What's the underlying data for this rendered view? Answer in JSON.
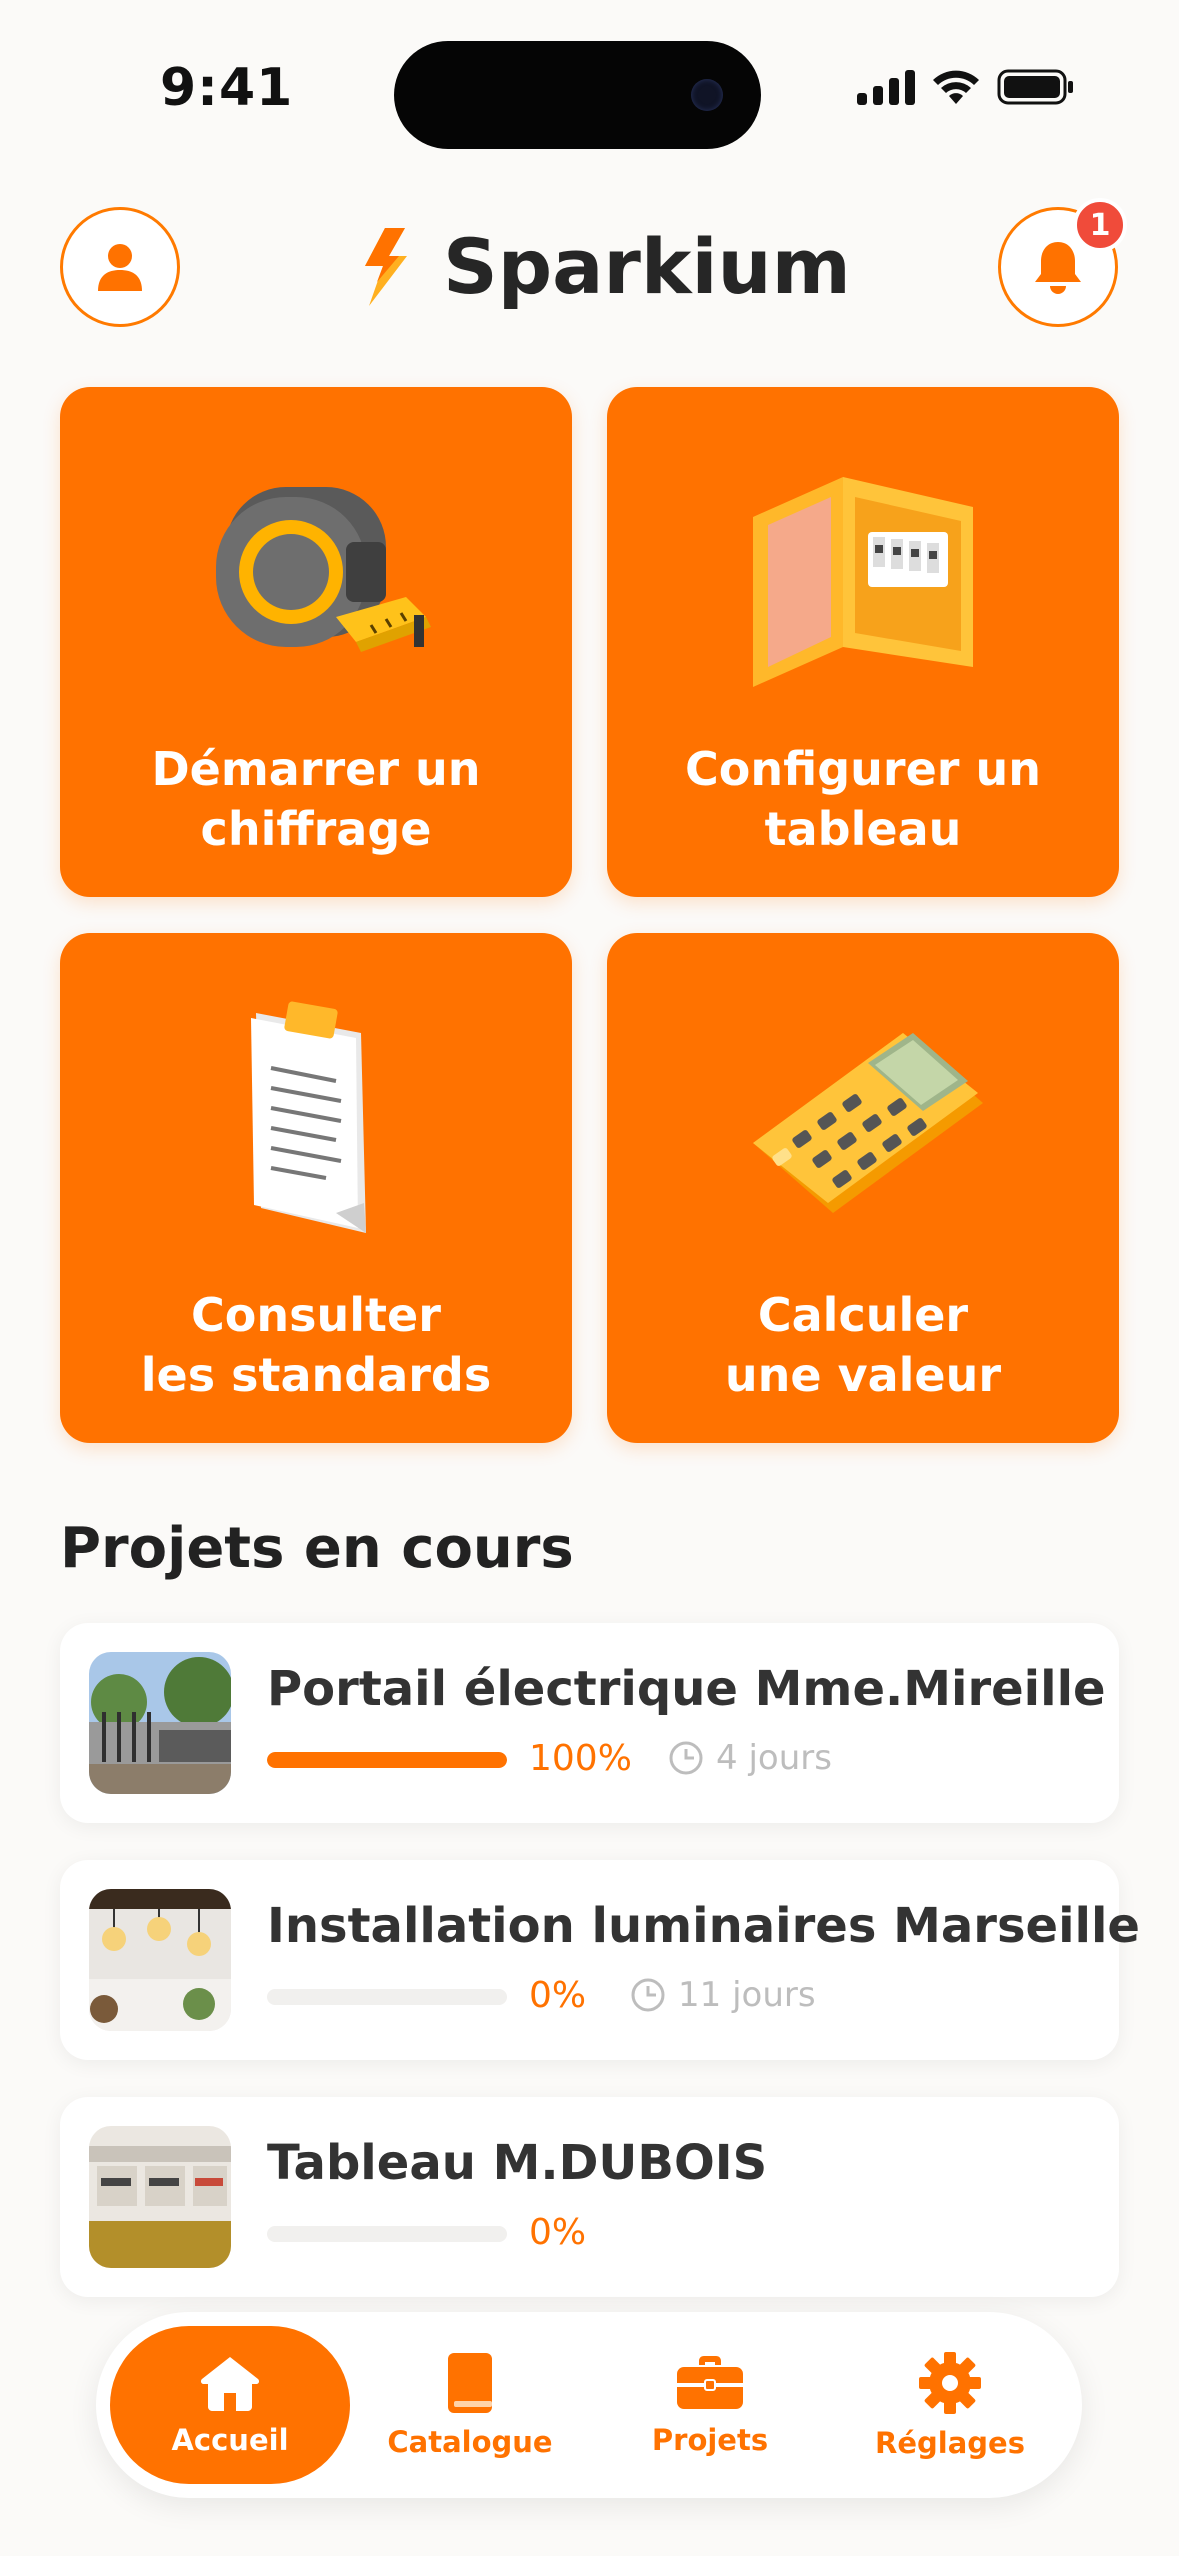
{
  "status_bar": {
    "time": "9:41"
  },
  "header": {
    "brand_name": "Sparkium",
    "notification_count": "1",
    "accent_color": "#ff7200"
  },
  "actions": [
    {
      "label": "Démarrer un\nchiffrage",
      "icon": "tape-measure-icon"
    },
    {
      "label": "Configurer un\ntableau",
      "icon": "electrical-panel-icon"
    },
    {
      "label": "Consulter\nles standards",
      "icon": "clipboard-document-icon"
    },
    {
      "label": "Calculer\nune valeur",
      "icon": "calculator-icon"
    }
  ],
  "projects": {
    "title": "Projets en cours",
    "items": [
      {
        "name": "Portail électrique Mme.Mireille",
        "progress_percent": 100,
        "progress_label": "100%",
        "days": "4 jours"
      },
      {
        "name": "Installation luminaires Marseille",
        "progress_percent": 0,
        "progress_label": "0%",
        "days": "11 jours"
      },
      {
        "name": "Tableau M.DUBOIS",
        "progress_percent": 0,
        "progress_label": "0%",
        "days": ""
      }
    ]
  },
  "nav": {
    "items": [
      {
        "label": "Accueil",
        "icon": "home-icon",
        "active": true
      },
      {
        "label": "Catalogue",
        "icon": "book-icon",
        "active": false
      },
      {
        "label": "Projets",
        "icon": "briefcase-icon",
        "active": false
      },
      {
        "label": "Réglages",
        "icon": "gear-icon",
        "active": false
      }
    ]
  }
}
